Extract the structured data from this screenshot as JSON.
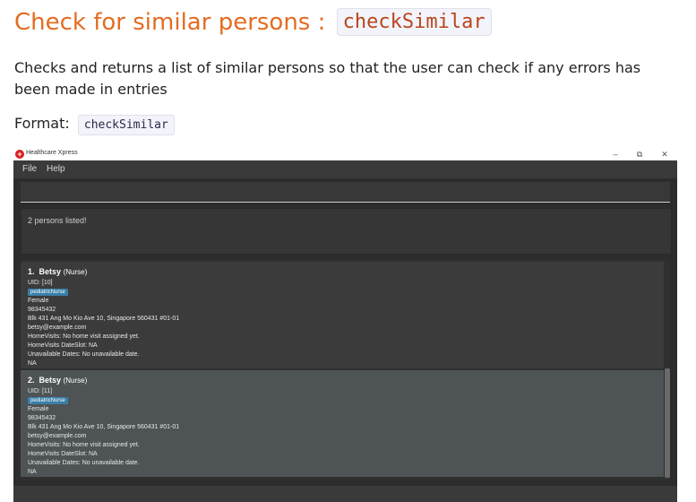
{
  "heading": {
    "text": "Check for similar persons : ",
    "code": "checkSimilar"
  },
  "description": "Checks and returns a list of similar persons so that the user can check if any errors has been made in entries",
  "format": {
    "label": "Format:",
    "code": "checkSimilar"
  },
  "app": {
    "title": "Healthcare Xpress",
    "icon": "red-cross-icon",
    "window_buttons": {
      "minimize": "–",
      "restore": "⧉",
      "close": "✕"
    },
    "menu": [
      "File",
      "Help"
    ],
    "command_input": "",
    "result": "2 persons listed!",
    "persons": [
      {
        "index": "1.",
        "name": "Betsy",
        "role": "(Nurse)",
        "uid": "UID: [10]",
        "tag": "pediatricNurse",
        "gender": "Female",
        "phone": "98345432",
        "address": "Blk 431 Ang Mo Kio Ave 10, Singapore 560431 #01-01",
        "email": "betsy@example.com",
        "home_visits": "HomeVisits: No home visit assigned yet.",
        "date_slot": "HomeVisits DateSlot: NA",
        "unavailable": "Unavailable Dates: No unavailable date.",
        "extra": "NA"
      },
      {
        "index": "2.",
        "name": "Betsy",
        "role": "(Nurse)",
        "uid": "UID: [11]",
        "tag": "pediatricNurse",
        "gender": "Female",
        "phone": "98345432",
        "address": "Blk 431 Ang Mo Kio Ave 10, Singapore 560431 #01-01",
        "email": "betsy@example.com",
        "home_visits": "HomeVisits: No home visit assigned yet.",
        "date_slot": "HomeVisits DateSlot: NA",
        "unavailable": "Unavailable Dates: No unavailable date.",
        "extra": "NA"
      }
    ]
  },
  "colors": {
    "heading": "#e46c22",
    "tag": "#3a7fa8",
    "app_bg": "#2c2c2c",
    "selected_card": "#4e5356"
  }
}
